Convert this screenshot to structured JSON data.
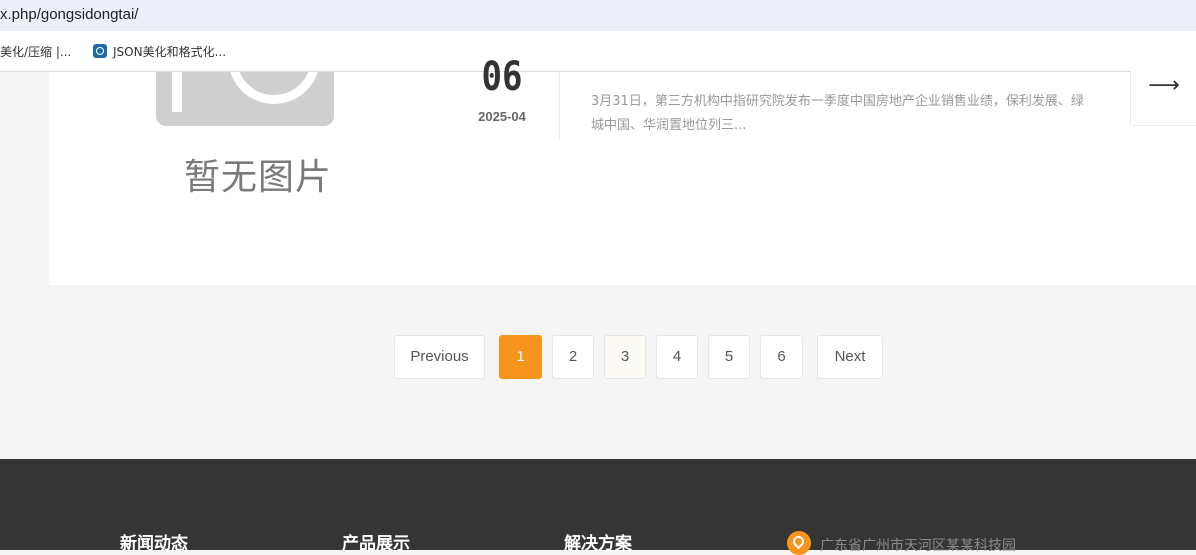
{
  "browser": {
    "address_text": "x.php/gongsidongtai/",
    "bookmarks": [
      {
        "label": "美化/压缩 |..."
      },
      {
        "label": "JSON美化和格式化..."
      }
    ]
  },
  "news_item": {
    "image_placeholder_text": "暂无图片",
    "date_day": "06",
    "date_year_month": "2025-04",
    "summary": "3月31日，第三方机构中指研究院发布一季度中国房地产企业销售业绩，保利发展、绿城中国、华润置地位列三...",
    "arrow": "⟶"
  },
  "pagination": {
    "previous_label": "Previous",
    "pages": [
      "1",
      "2",
      "3",
      "4",
      "5",
      "6"
    ],
    "current_page": "1",
    "next_label": "Next"
  },
  "footer": {
    "headings": [
      "新闻动态",
      "产品展示",
      "解决方案"
    ],
    "address": "广东省广州市天河区某某科技园"
  },
  "colors": {
    "accent": "#f7941d",
    "footer_bg": "#353535",
    "page_bg": "#f5f5f5"
  }
}
